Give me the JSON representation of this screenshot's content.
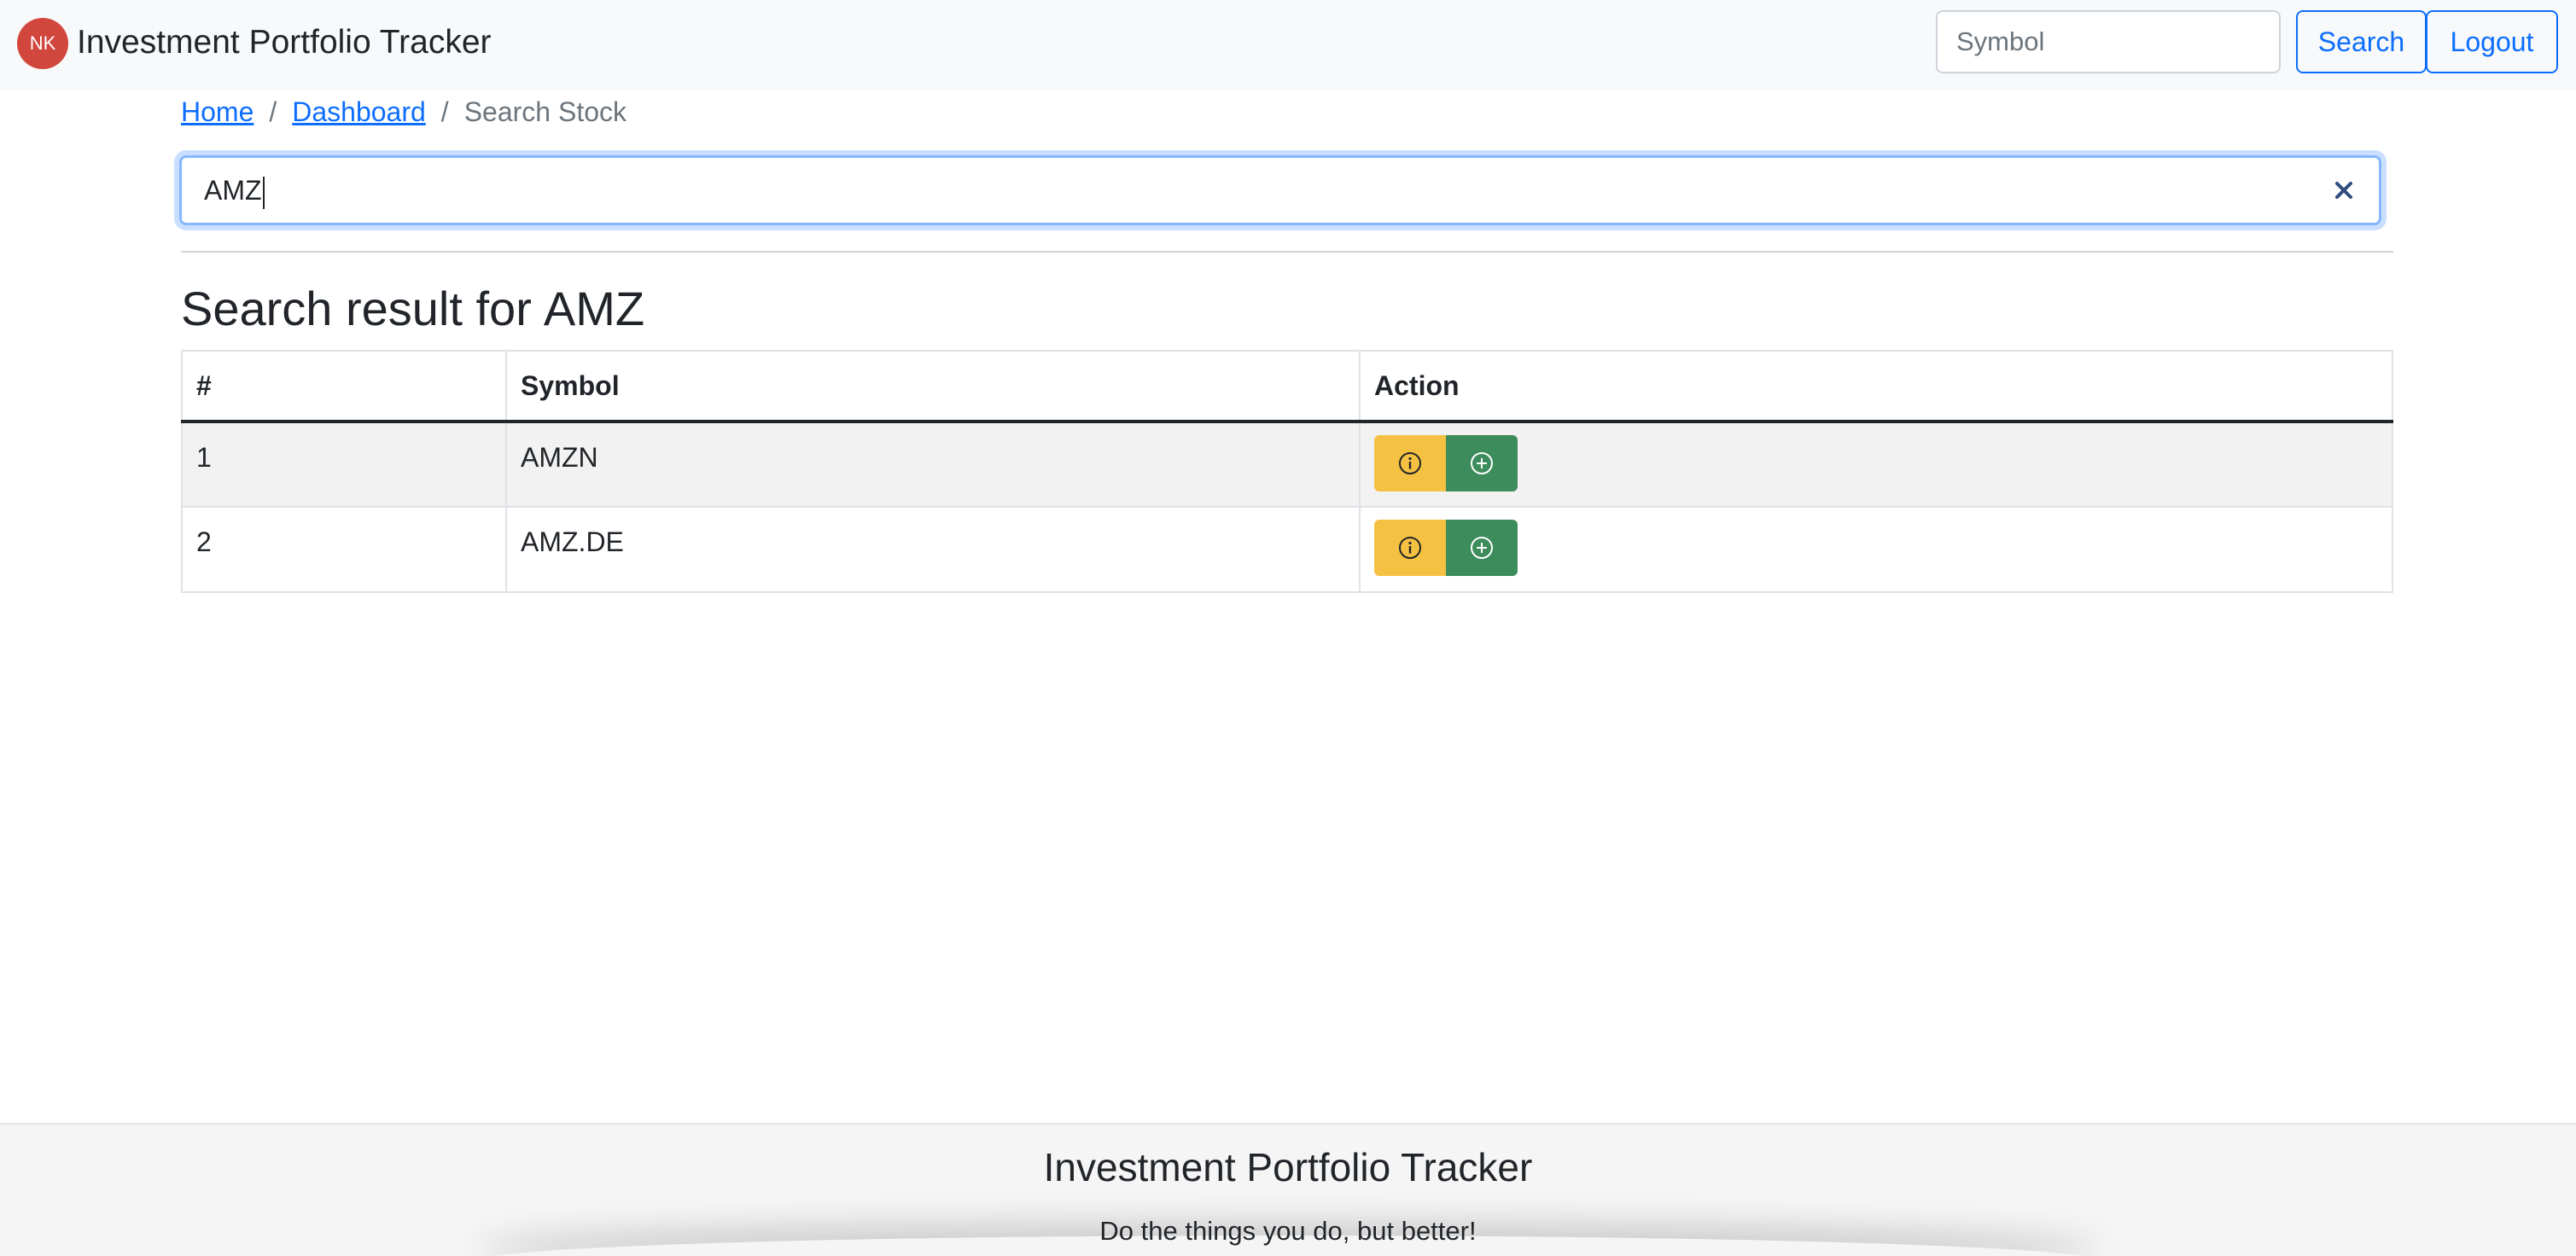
{
  "navbar": {
    "avatar_initials": "NK",
    "brand": "Investment Portfolio Tracker",
    "search_placeholder": "Symbol",
    "search_label": "Search",
    "logout_label": "Logout"
  },
  "breadcrumb": {
    "home": "Home",
    "separator": "/",
    "dashboard": "Dashboard",
    "current": "Search Stock"
  },
  "search": {
    "value": "AMZ",
    "clear_icon": "close-icon"
  },
  "results": {
    "heading_prefix": "Search result for",
    "query": "AMZ",
    "columns": [
      "#",
      "Symbol",
      "Action"
    ],
    "rows": [
      {
        "index": "1",
        "symbol": "AMZN"
      },
      {
        "index": "2",
        "symbol": "AMZ.DE"
      }
    ],
    "action_icons": [
      "info-circle-icon",
      "plus-circle-icon"
    ]
  },
  "footer": {
    "title": "Investment Portfolio Tracker",
    "tagline": "Do the things you do, but better!"
  },
  "colors": {
    "primary": "#0d6efd",
    "avatar": "#d2473d",
    "info_button": "#f5c142",
    "add_button": "#3d8c5c",
    "navbar_bg": "#f8f9fa"
  }
}
